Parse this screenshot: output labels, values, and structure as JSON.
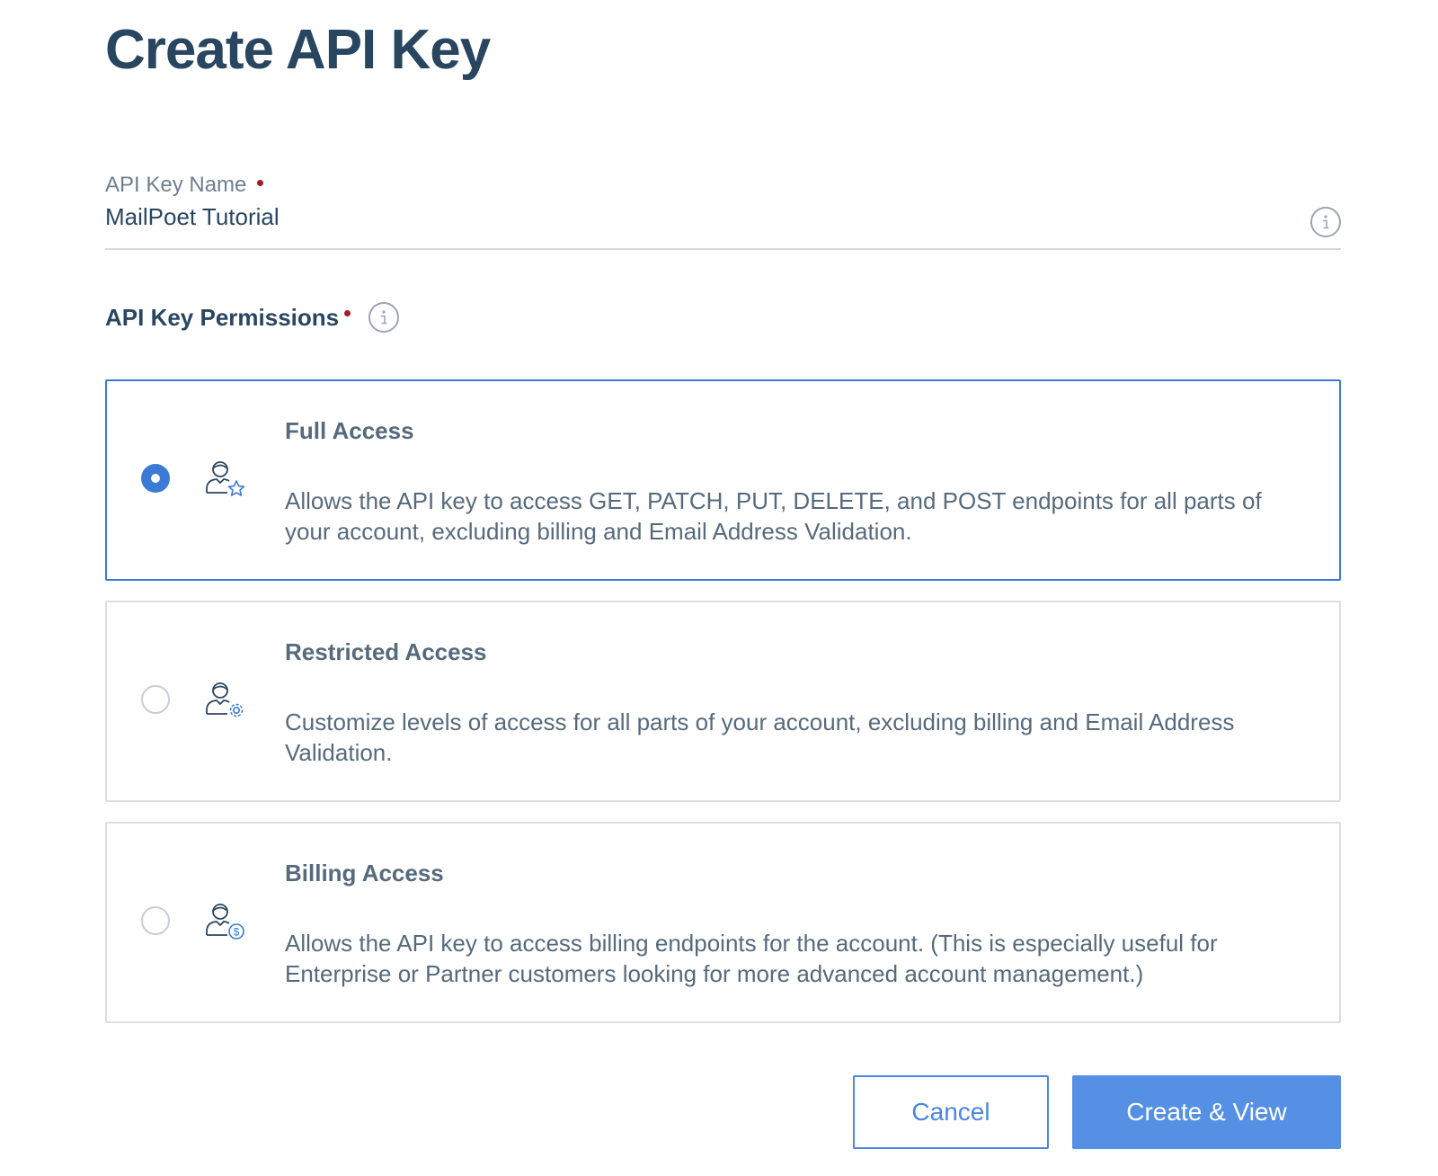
{
  "page": {
    "title": "Create API Key"
  },
  "name_field": {
    "label": "API Key Name",
    "value": "MailPoet Tutorial",
    "required": true,
    "info_icon": "info-icon"
  },
  "permissions": {
    "heading": "API Key Permissions",
    "required": true,
    "info_icon": "info-icon",
    "selected": "full-access",
    "options": [
      {
        "id": "full-access",
        "title": "Full Access",
        "description": "Allows the API key to access GET, PATCH, PUT, DELETE, and POST endpoints for all parts of your account, excluding billing and Email Address Validation.",
        "icon": "user-star-icon",
        "selected": true
      },
      {
        "id": "restricted-access",
        "title": "Restricted Access",
        "description": "Customize levels of access for all parts of your account, excluding billing and Email Address Validation.",
        "icon": "user-gear-icon",
        "selected": false
      },
      {
        "id": "billing-access",
        "title": "Billing Access",
        "description": "Allows the API key to access billing endpoints for the account. (This is especially useful for Enterprise or Partner customers looking for more advanced account management.)",
        "icon": "user-dollar-icon",
        "selected": false
      }
    ]
  },
  "actions": {
    "cancel_label": "Cancel",
    "create_label": "Create & View"
  },
  "colors": {
    "primary": "#3a7bd5",
    "button_primary": "#5590e4",
    "heading": "#294661",
    "required_dot": "#a5192b"
  }
}
